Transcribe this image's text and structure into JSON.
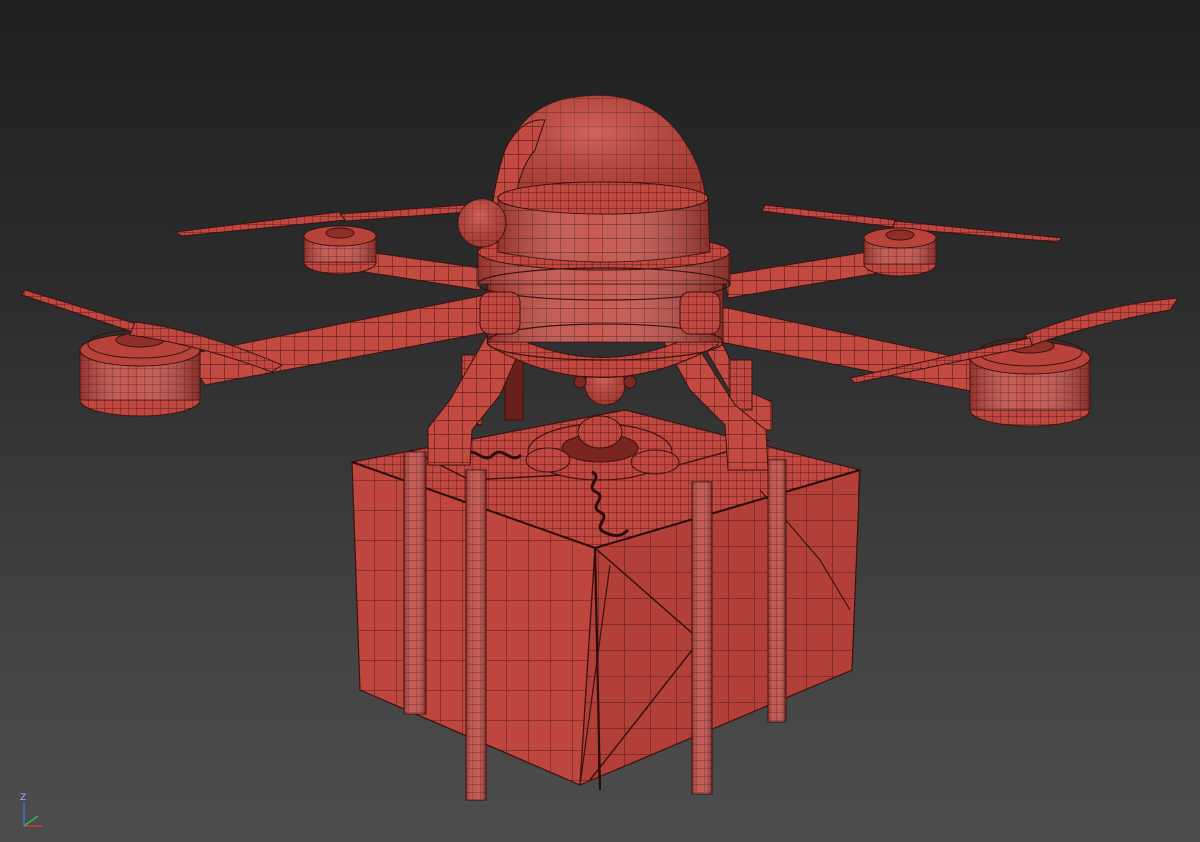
{
  "viewport": {
    "view_label": "",
    "background_top": "#202020",
    "background_bottom": "#4d4d4d",
    "shading": "edged-faces",
    "object": {
      "name": "santa-delivery-drone",
      "material_color": "#c0443d",
      "wire_color": "#3a1210",
      "parts": [
        "santa-hat",
        "hat-pompom",
        "drone-body",
        "motor-pods",
        "propellers",
        "arms",
        "landing-legs",
        "camera-gimbal",
        "gift-box",
        "gift-bow",
        "ribbon-curls"
      ]
    }
  },
  "axis_gizmo": {
    "z_label": "Z",
    "x_color": "#d23a3a",
    "y_color": "#3fb34f",
    "z_color": "#4a6bd8"
  }
}
